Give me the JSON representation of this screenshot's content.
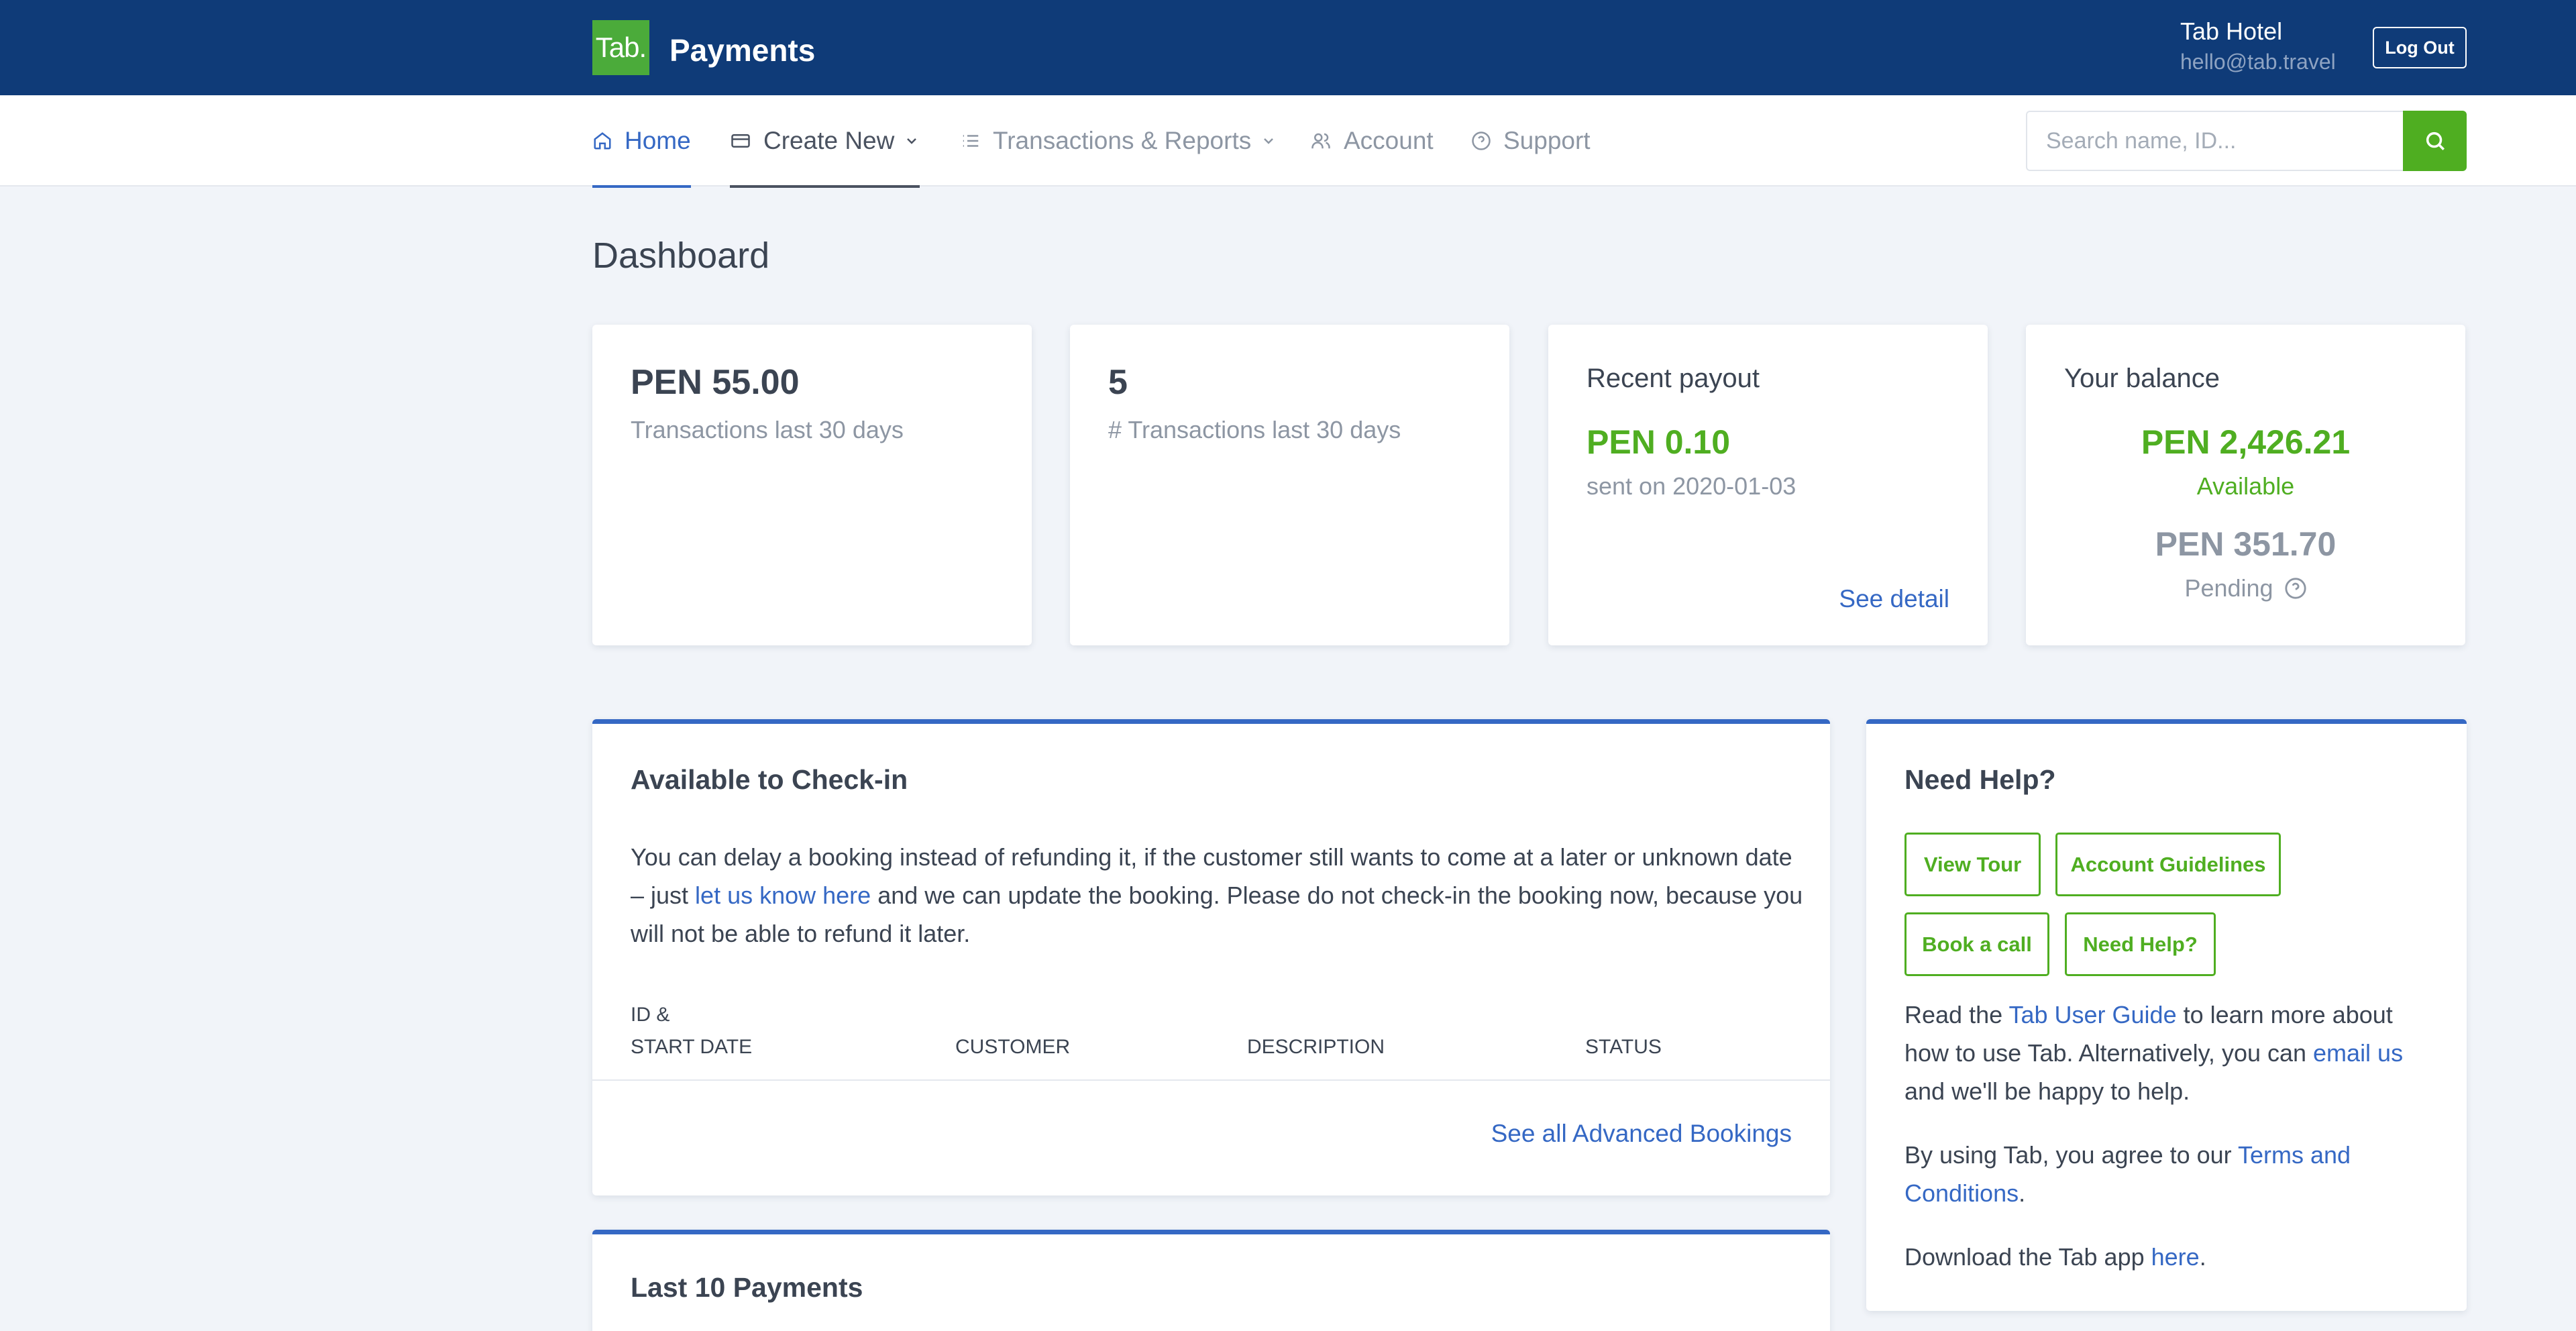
{
  "header": {
    "logo_text": "Tab.",
    "app_title": "Payments",
    "user_name": "Tab Hotel",
    "user_email": "hello@tab.travel",
    "logout_label": "Log Out"
  },
  "nav": {
    "items": [
      {
        "label": "Home",
        "icon": "home-icon"
      },
      {
        "label": "Create New",
        "icon": "card-icon"
      },
      {
        "label": "Transactions & Reports",
        "icon": "list-icon"
      },
      {
        "label": "Account",
        "icon": "users-icon"
      },
      {
        "label": "Support",
        "icon": "help-circle-icon"
      }
    ],
    "active": "Home",
    "search_placeholder": "Search name, ID..."
  },
  "page": {
    "title": "Dashboard"
  },
  "stats": {
    "transactions_amount": "PEN 55.00",
    "transactions_amount_label": "Transactions last 30 days",
    "transactions_count": "5",
    "transactions_count_label": "# Transactions last 30 days",
    "payout_heading": "Recent payout",
    "payout_amount": "PEN 0.10",
    "payout_date": "sent on 2020-01-03",
    "payout_link": "See detail",
    "balance_heading": "Your balance",
    "balance_available": "PEN 2,426.21",
    "balance_available_label": "Available",
    "balance_pending": "PEN 351.70",
    "balance_pending_label": "Pending"
  },
  "checkin": {
    "title": "Available to Check-in",
    "text_before": "You can delay a booking instead of refunding it, if the customer still wants to come at a later or unknown date – just ",
    "text_link": "let us know here",
    "text_after": " and we can update the booking. Please do not check-in the booking now, because you will not be able to refund it later.",
    "columns": [
      "ID &",
      "START DATE",
      "CUSTOMER",
      "DESCRIPTION",
      "STATUS"
    ],
    "see_all": "See all Advanced Bookings"
  },
  "payments": {
    "title": "Last 10 Payments"
  },
  "help": {
    "title": "Need Help?",
    "buttons": [
      "View Tour",
      "Account Guidelines",
      "Book a call",
      "Need Help?"
    ],
    "guide_before": "Read the ",
    "guide_link": "Tab User Guide",
    "guide_middle": " to learn more about how to use Tab. Alternatively, you can ",
    "guide_email": "email us",
    "guide_after": " and we'll be happy to help.",
    "terms_before": "By using Tab, you agree to our ",
    "terms_link": "Terms and Conditions",
    "terms_after": ".",
    "app_before": "Download the Tab app ",
    "app_link": "here",
    "app_after": "."
  },
  "colors": {
    "header_bg": "#0f3b78",
    "accent_blue": "#3568c4",
    "accent_green": "#4fae21"
  }
}
